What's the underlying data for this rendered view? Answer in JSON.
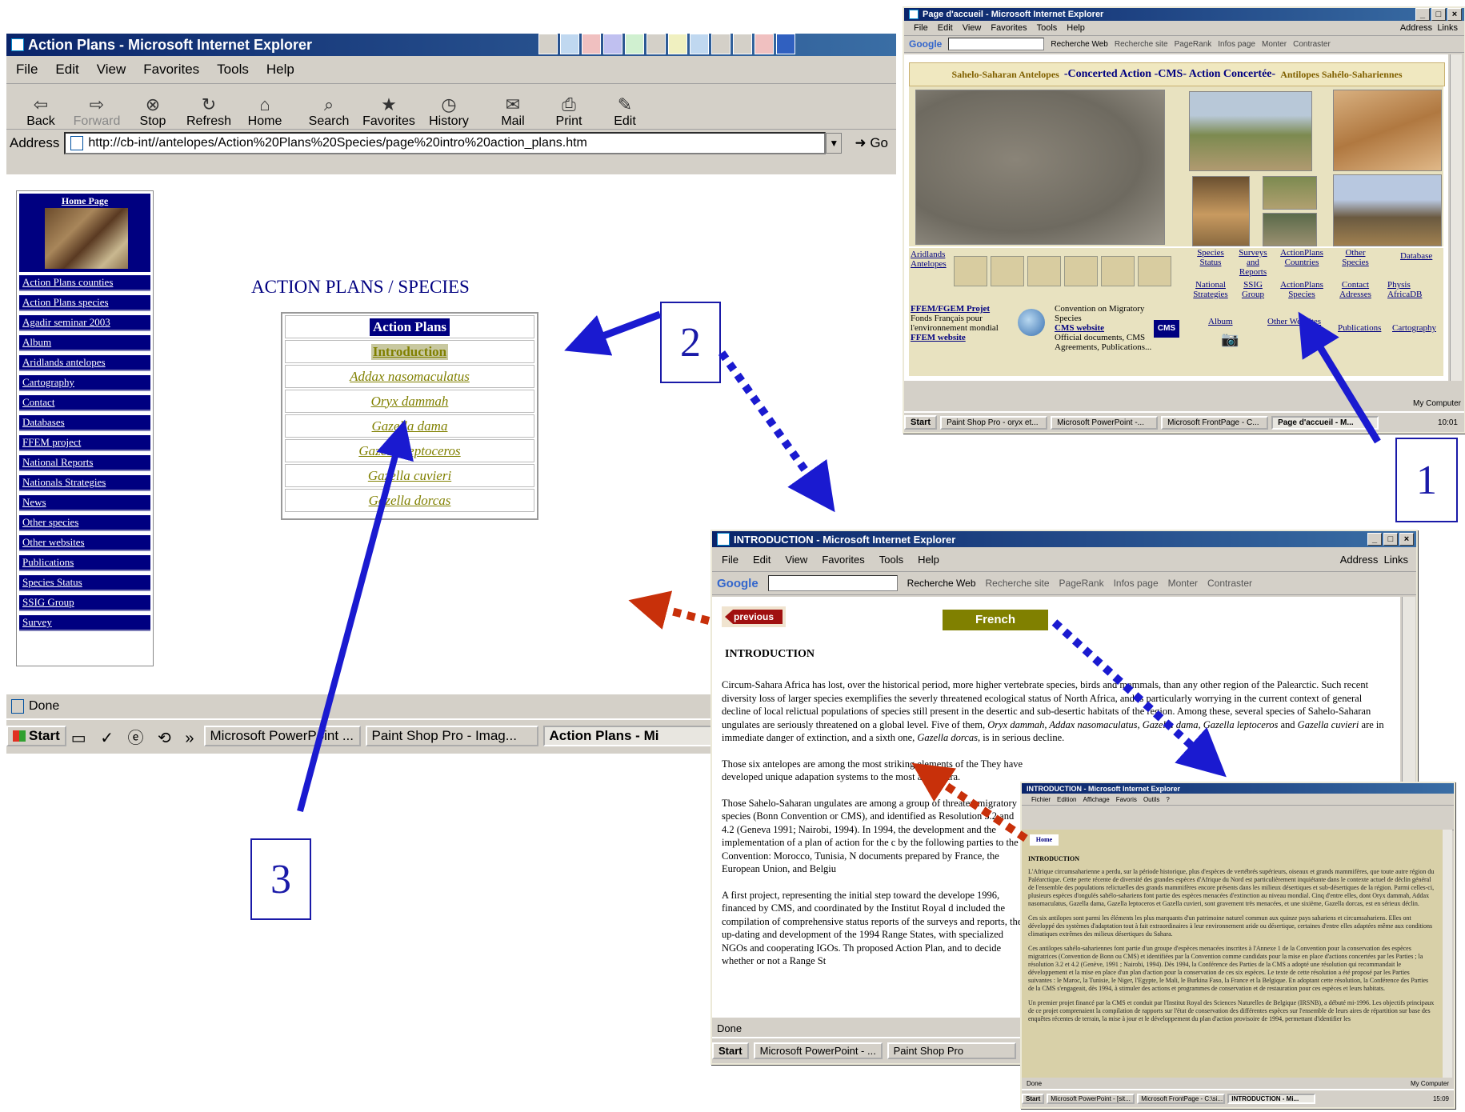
{
  "main_window": {
    "title": "Action Plans - Microsoft Internet Explorer",
    "menu": [
      "File",
      "Edit",
      "View",
      "Favorites",
      "Tools",
      "Help"
    ],
    "toolbar": [
      "Back",
      "Forward",
      "Stop",
      "Refresh",
      "Home",
      "Search",
      "Favorites",
      "History",
      "Mail",
      "Print",
      "Edit"
    ],
    "address_label": "Address",
    "address": "http://cb-int//antelopes/Action%20Plans%20Species/page%20intro%20action_plans.htm",
    "go_label": "Go",
    "nav_title": "Home Page",
    "nav_links": [
      "Action Plans counties",
      "Action Plans species",
      "Agadir seminar 2003",
      "Album",
      "Aridlands antelopes",
      "Cartography",
      "Contact",
      "Databases",
      "FFEM project",
      "National Reports",
      "Nationals Strategies",
      "News",
      "Other species",
      "Other websites",
      "Publications",
      "Species Status",
      "SSIG Group",
      "Survey"
    ],
    "page_heading": "ACTION PLANS / SPECIES",
    "table_header": "Action Plans",
    "table_intro": "Introduction",
    "species": [
      "Addax nasomaculatus",
      "Oryx dammah",
      "Gazella dama",
      "Gazella leptoceros",
      "Gazella cuvieri",
      "Gazella dorcas"
    ],
    "status": "Done",
    "taskbar": {
      "start": "Start",
      "tasks": [
        "Microsoft PowerPoint ...",
        "Paint Shop Pro - Imag...",
        "Action Plans - Mi"
      ]
    }
  },
  "accueil_window": {
    "title": "Page d'accueil - Microsoft Internet Explorer",
    "menu": [
      "File",
      "Edit",
      "View",
      "Favorites",
      "Tools",
      "Help"
    ],
    "address_label": "Address",
    "links_label": "Links",
    "google_toolbar": [
      "Google",
      "Recherche Web",
      "Recherche site",
      "PageRank",
      "Infos page",
      "Monter",
      "Contraster"
    ],
    "banner_left": "Sahelo-Saharan Antelopes",
    "banner_mid": "-Concerted Action -CMS- Action Concertée-",
    "banner_right": "Antilopes Sahélo-Sahariennes",
    "links_row1": [
      "Aridlands Antelopes",
      "Species Status",
      "Surveys and Reports",
      "ActionPlans Countries",
      "Other Species",
      "Database"
    ],
    "links_row2": [
      "National Strategies",
      "SSIG Group",
      "ActionPlans Species",
      "Contact Adresses",
      "Physis AfricaDB"
    ],
    "ffem_title": "FFEM/FGEM Projet",
    "ffem_text": "Fonds Français pour l'environnement mondial",
    "ffem_link": "FFEM website",
    "cms_text1": "Convention on Migratory Species",
    "cms_link": "CMS website",
    "cms_text2": "Official documents, CMS Agreements, Publications...",
    "cms_logo": "CMS",
    "bottom_links": [
      "Album",
      "Other Websites",
      "Publications",
      "Cartography"
    ],
    "status_right": "My Computer",
    "taskbar": {
      "start": "Start",
      "tasks": [
        "Paint Shop Pro - oryx et...",
        "Microsoft PowerPoint -...",
        "Microsoft FrontPage - C...",
        "Page d'accueil - M..."
      ],
      "clock": "10:01"
    }
  },
  "intro_window": {
    "title": "INTRODUCTION - Microsoft Internet Explorer",
    "menu": [
      "File",
      "Edit",
      "View",
      "Favorites",
      "Tools",
      "Help"
    ],
    "address_label": "Address",
    "links_label": "Links",
    "google_toolbar": [
      "Google",
      "Recherche Web",
      "Recherche site",
      "PageRank",
      "Infos page",
      "Monter",
      "Contraster"
    ],
    "previous_btn": "previous",
    "french_btn": "French",
    "heading": "INTRODUCTION",
    "p1a": "Circum-Sahara Africa has lost, over the historical period, more higher vertebrate species, birds and mammals, than any other region of the Palearctic. Such recent diversity loss of larger species exemplifies the severly threatened ecological status of North Africa, and is particularly worrying in the current context of general decline of local relictual populations of species still present in the desertic and sub-desertic habitats of the region. Among these, several species of Sahelo-Saharan ungulates are seriously threatened on a global level. Five of them,",
    "p1_species1": "Oryx dammah, Addax nasomaculatus, Gazella dama, Gazella leptoceros",
    "p1_and": "and",
    "p1_species2": "Gazella cuvieri",
    "p1b": "are in immediate danger of extinction, and a sixth one,",
    "p1_species3": "Gazella dorcas",
    "p1c": ", is in serious decline.",
    "p2": "Those six antelopes are among the most striking elements of the  They have developed unique adapation systems to the most ari Sahara.",
    "p3": "Those Sahelo-Saharan ungulates are among a group of threaten migratory species (Bonn Convention or CMS), and identified as Resolution 3.2 and 4.2 (Geneva 1991; Nairobi, 1994). In 1994, the development and the implementation of a plan of action for the c by the following parties to the Convention: Morocco, Tunisia, N documents prepared by France, the European Union, and Belgiu",
    "p4": "A first project, representing the initial step toward the develope 1996, financed by CMS, and coordinated by the Institut Royal d included the compilation of comprehensive status reports of the surveys and reports, the up-dating and development of the 1994 Range States, with specialized NGOs and cooperating IGOs. Th proposed Action Plan, and to decide whether or not a Range St",
    "status": "Done",
    "taskbar": {
      "start": "Start",
      "tasks": [
        "Microsoft PowerPoint - ...",
        "Paint Shop Pro"
      ]
    }
  },
  "french_window": {
    "title": "INTRODUCTION - Microsoft Internet Explorer",
    "menu": [
      "Fichier",
      "Edition",
      "Affichage",
      "Favoris",
      "Outils",
      "?"
    ],
    "home_btn": "Home",
    "heading": "INTRODUCTION",
    "para1": "L'Afrique circumsaharienne a perdu, sur la période historique, plus d'espèces de vertébrés supérieurs, oiseaux et grands mammifères, que toute autre région du Paléarctique. Cette perte récente de diversité des grandes espèces d'Afrique du Nord est particulièrement inquiétante dans le contexte actuel de déclin général de l'ensemble des populations relictuelles des grands mammifères encore présents dans les milieux désertiques et sub-désertiques de la région. Parmi celles-ci, plusieurs espèces d'ongulés sahélo-sahariens font partie des espèces menacées d'extinction au niveau mondial. Cinq d'entre elles, dont Oryx dammah, Addax nasomaculatus, Gazella dama, Gazella leptoceros et Gazella cuvieri, sont gravement très menacées, et une sixième, Gazella dorcas, est en sérieux déclin.",
    "para2": "Ces six antilopes sont parmi les éléments les plus marquants d'un patrimoine naturel commun aux quinze pays sahariens et circumsahariens. Elles ont développé des systèmes d'adaptation tout à fait extraordinaires à leur environnement aride ou désertique, certaines d'entre elles adaptées même aux conditions climatiques extrêmes des milieux désertiques du Sahara.",
    "para3": "Ces antilopes sahélo-sahariennes font partie d'un groupe d'espèces menacées inscrites à l'Annexe 1 de la Convention pour la conservation des espèces migratrices (Convention de Bonn ou CMS) et identifiées par la Convention comme candidats pour la mise en place d'actions concertées par les Parties ; la résolution 3.2 et 4.2 (Genève, 1991 ; Nairobi, 1994). Dès 1994, la Conférence des Parties de la CMS a adopté une résolution qui recommandait le développement et la mise en place d'un plan d'action pour la conservation de ces six espèces. Le texte de cette résolution a été proposé par les Parties suivantes : le Maroc, la Tunisie, le Niger, l'Egypte, le Mali, le Burkina Faso, la France et la Belgique. En adoptant cette résolution, la Conférence des Parties de la CMS s'engageait, dès 1994, à stimuler des actions et programmes de conservation et de restauration pour ces espèces et leurs habitats.",
    "para4": "Un premier projet financé par la CMS et conduit par l'Institut Royal des Sciences Naturelles de Belgique (IRSNB), a débuté mi-1996. Les objectifs principaux de ce projet comprenaient la compilation de rapports sur l'état de conservation des différentes espèces sur l'ensemble de leurs aires de répartition sur base des enquêtes récentes de terrain, la mise à jour et le développement du plan d'action provisoire de 1994, permettant d'identifier les",
    "status": "Done",
    "status_right": "My Computer",
    "taskbar": {
      "start": "Start",
      "tasks": [
        "Microsoft PowerPoint - [sit...",
        "Microsoft FrontPage - C:\\si...",
        "INTRODUCTION - Mi..."
      ],
      "clock": "15:09"
    }
  },
  "callouts": [
    "1",
    "2",
    "3"
  ],
  "colors": {
    "arrow_blue": "#1a1ad0",
    "arrow_red": "#c8300a",
    "nav_blue": "#000080",
    "olive": "#808000"
  }
}
